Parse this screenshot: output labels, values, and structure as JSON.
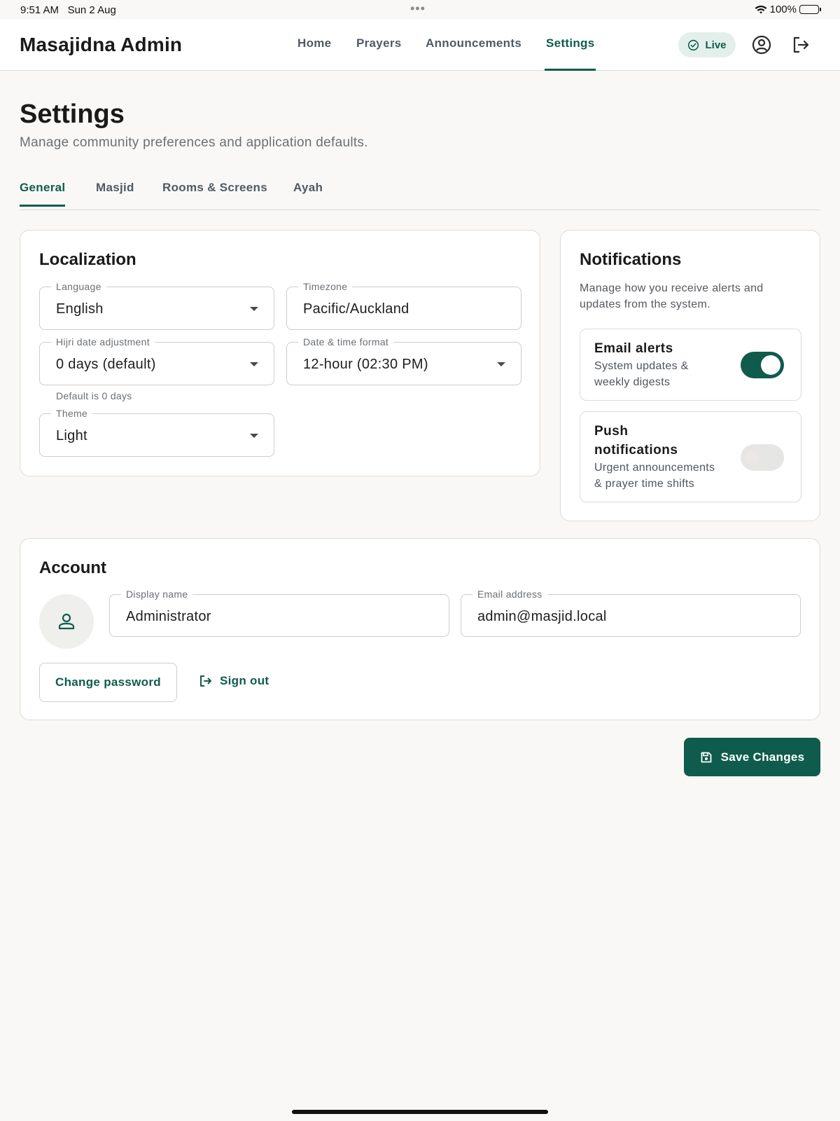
{
  "status_bar": {
    "time": "9:51 AM",
    "date": "Sun 2 Aug",
    "battery": "100%"
  },
  "nav": {
    "brand": "Masajidna Admin",
    "links": [
      "Home",
      "Prayers",
      "Announcements",
      "Settings"
    ],
    "active_link": "Settings",
    "live_label": "Live"
  },
  "page": {
    "title": "Settings",
    "subtitle": "Manage community preferences and application defaults."
  },
  "tabs": {
    "items": [
      "General",
      "Masjid",
      "Rooms & Screens",
      "Ayah"
    ],
    "active": "General"
  },
  "localization": {
    "title": "Localization",
    "language": {
      "label": "Language",
      "value": "English"
    },
    "timezone": {
      "label": "Timezone",
      "value": "Pacific/Auckland"
    },
    "hijri": {
      "label": "Hijri date adjustment",
      "value": "0 days (default)",
      "helper": "Default is 0 days"
    },
    "datetime": {
      "label": "Date & time format",
      "value": "12-hour (02:30 PM)"
    },
    "theme": {
      "label": "Theme",
      "value": "Light"
    }
  },
  "notifications": {
    "title": "Notifications",
    "description_line1": "Manage how you receive alerts and",
    "description_line2": "updates from the system.",
    "email": {
      "title": "Email alerts",
      "desc_line1": "System updates &",
      "desc_line2": "weekly digests",
      "enabled": true
    },
    "push": {
      "title_line1": "Push",
      "title_line2": "notifications",
      "desc_line1": "Urgent announcements",
      "desc_line2": "& prayer time shifts",
      "enabled": false
    }
  },
  "account": {
    "title": "Account",
    "display_name": {
      "label": "Display name",
      "value": "Administrator"
    },
    "email": {
      "label": "Email address",
      "value": "admin@masjid.local"
    },
    "change_password_label": "Change password",
    "sign_out_label": "Sign out"
  },
  "save_label": "Save Changes",
  "colors": {
    "accent": "#0f5c4c",
    "accent_light": "#e3efea",
    "background": "#f9f8f6",
    "muted_text": "#6b6f74"
  },
  "icons": [
    "wifi-icon",
    "battery-icon",
    "check-circle-icon",
    "account-circle-icon",
    "logout-icon",
    "person-icon",
    "save-icon"
  ]
}
